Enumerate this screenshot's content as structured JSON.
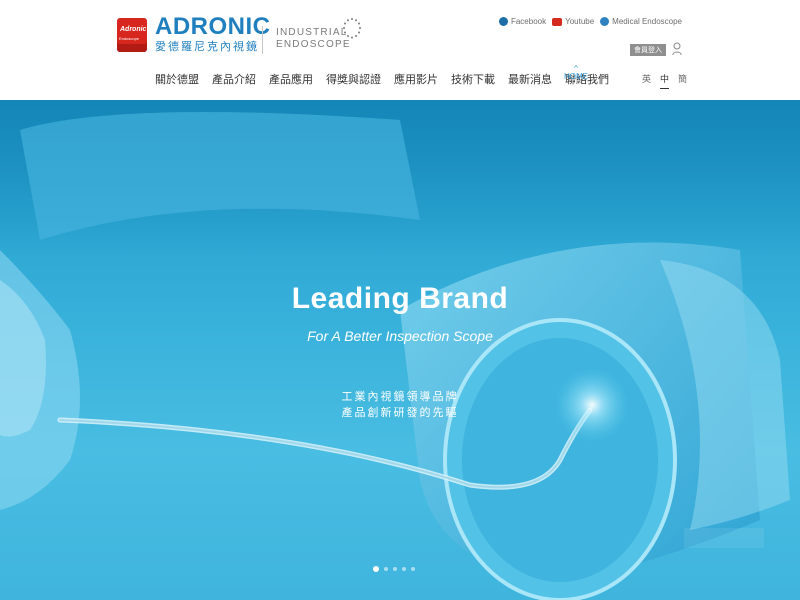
{
  "brand": {
    "logo_badge_top": "Adronic",
    "logo_badge_bottom": "Endoscope",
    "name_en": "ADRONIC",
    "name_cn": "愛德羅尼克內視鏡",
    "sub_line1": "INDUSTRIAL",
    "sub_line2": "ENDOSCOPE",
    "color": "#1f7fbf"
  },
  "social": {
    "facebook": "Facebook",
    "youtube": "Youtube",
    "medical": "Medical Endoscope"
  },
  "member_button": "會員登入",
  "nav": {
    "items": [
      "關於德盟",
      "產品介紹",
      "產品應用",
      "得獎與認證",
      "應用影片",
      "技術下載",
      "最新消息",
      "聯絡我們"
    ],
    "home": "HOME",
    "active_color": "#3aa3de"
  },
  "lang": {
    "items": [
      "英",
      "中",
      "簡"
    ],
    "active": "中"
  },
  "hero": {
    "title": "Leading Brand",
    "subtitle": "For A Better Inspection Scope",
    "cn_line1": "工業內視鏡領導品牌",
    "cn_line2": "產品創新研發的先驅",
    "slides": 5,
    "active_slide": 1
  }
}
